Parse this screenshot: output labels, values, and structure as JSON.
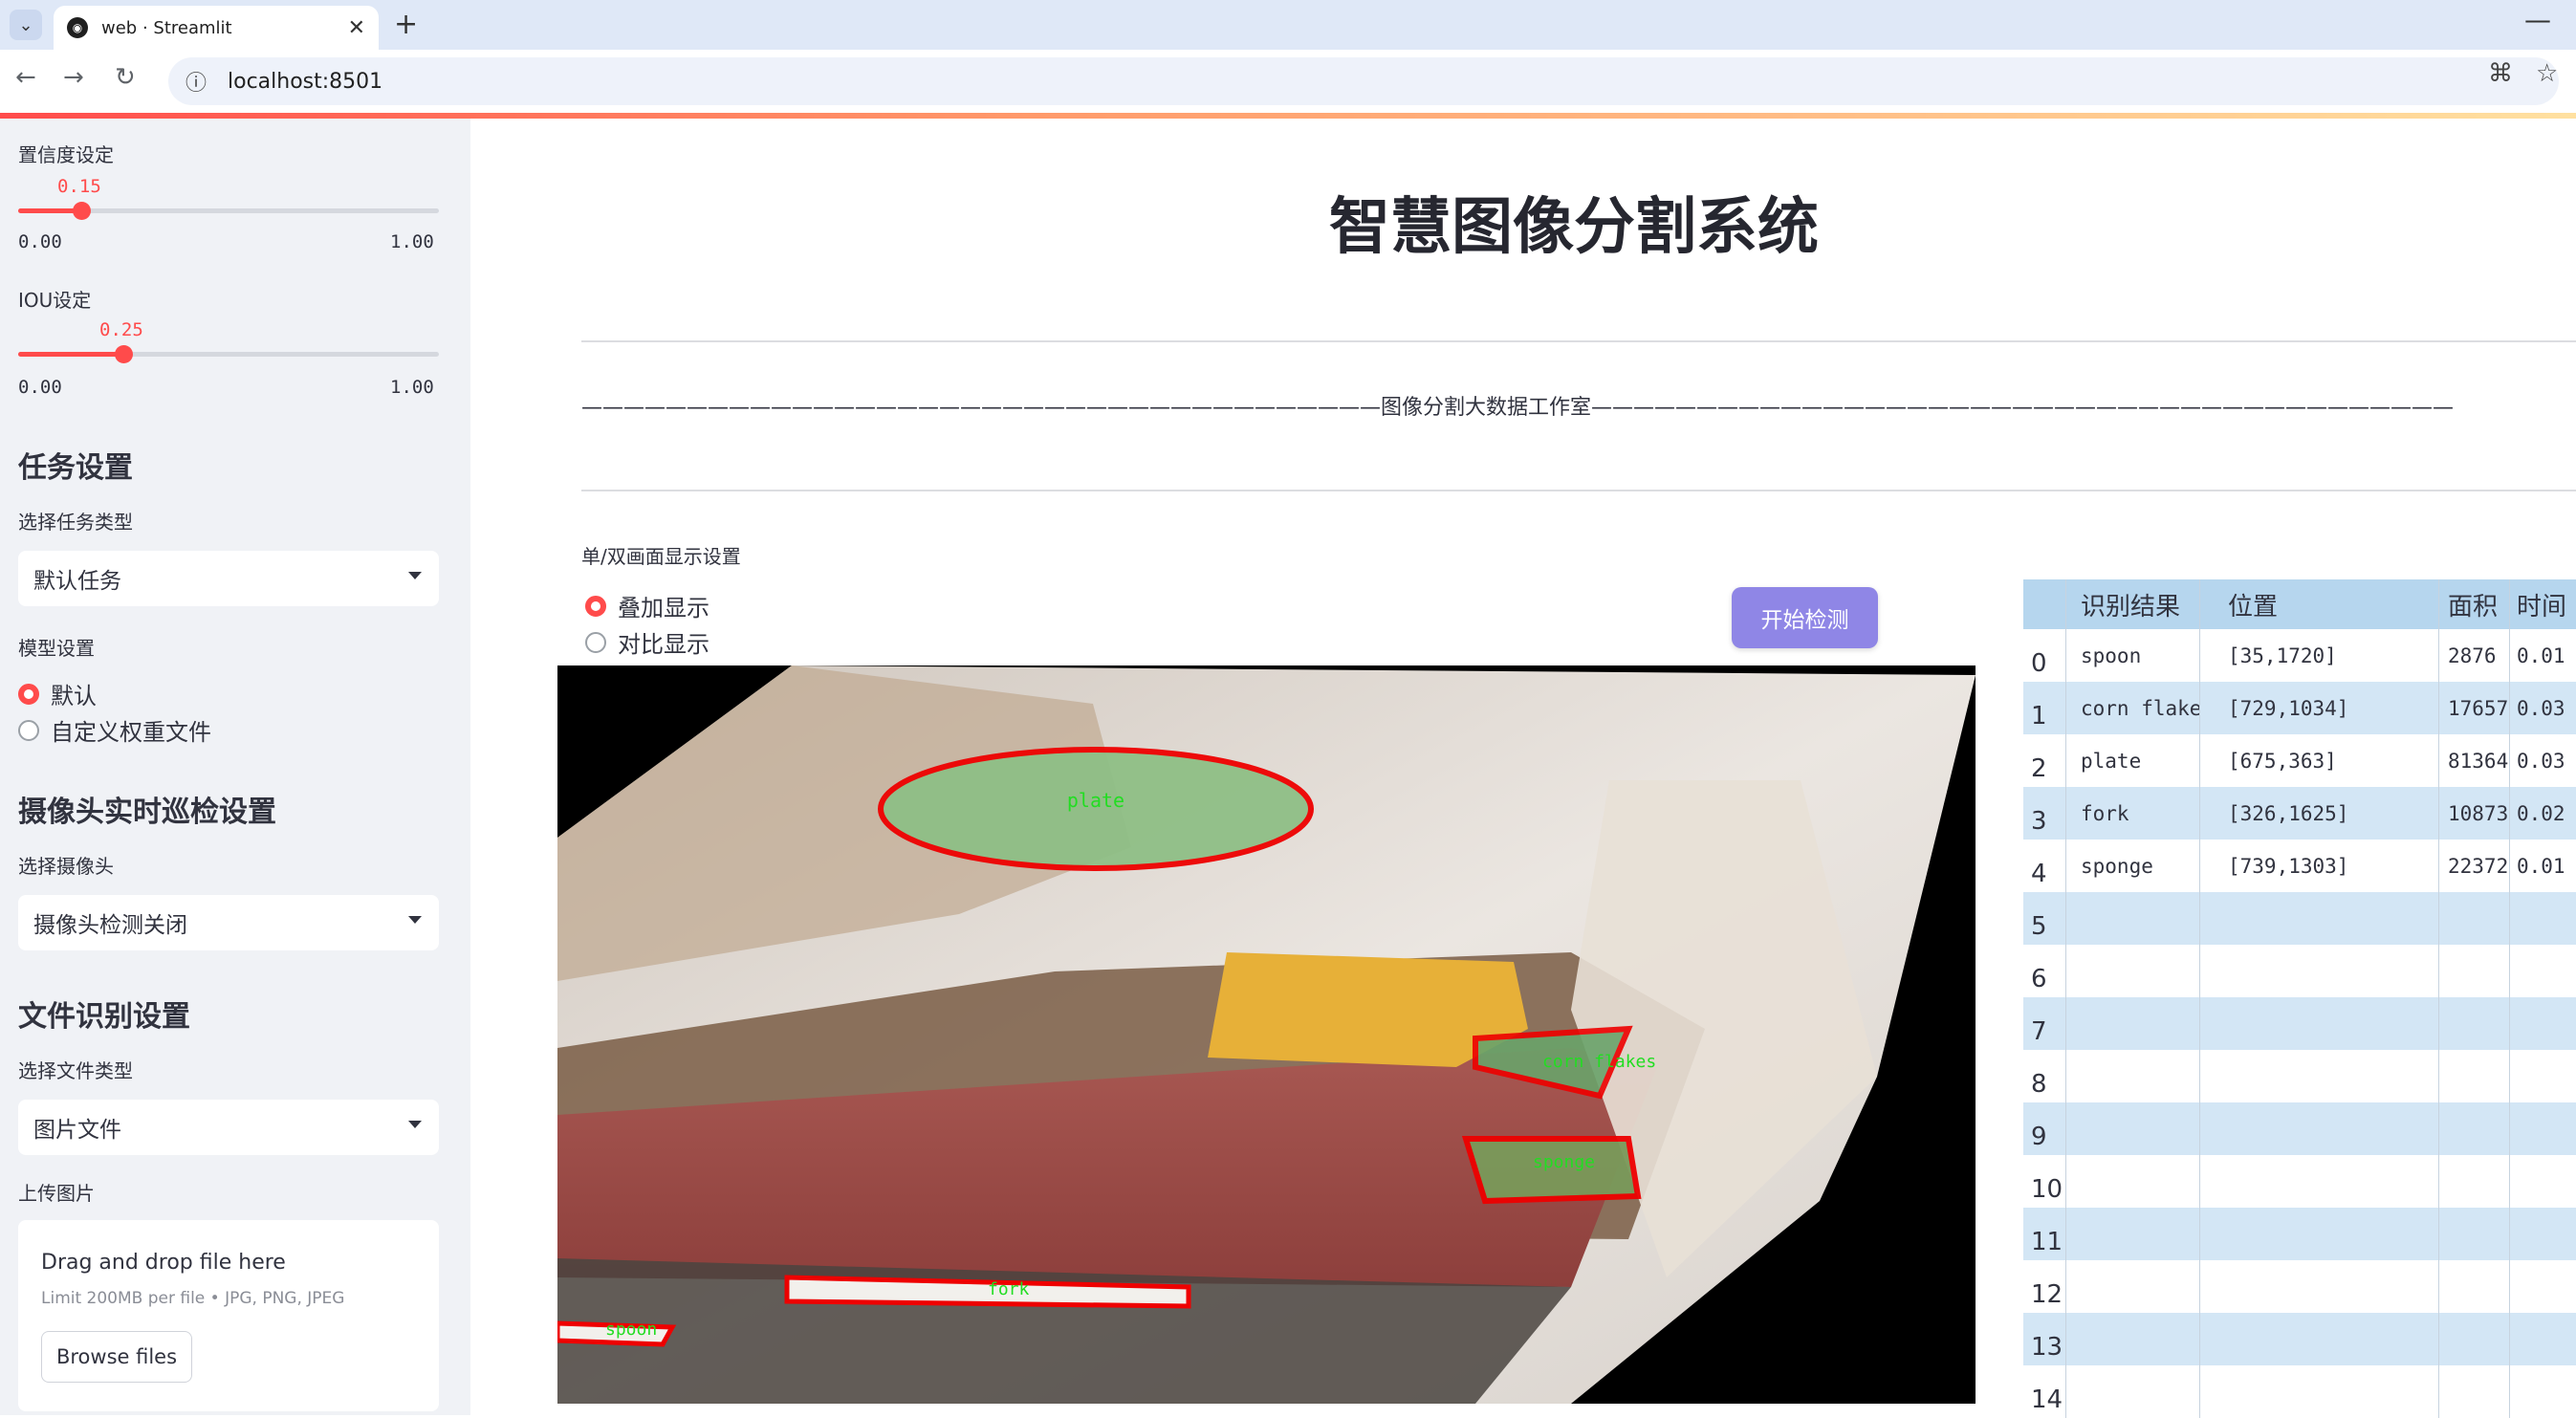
{
  "browser": {
    "tab_title": "web · Streamlit",
    "url": "localhost:8501"
  },
  "sidebar": {
    "confidence": {
      "label": "置信度设定",
      "value": "0.15",
      "value_num": 0.15,
      "min": "0.00",
      "max": "1.00"
    },
    "iou": {
      "label": "IOU设定",
      "value": "0.25",
      "value_num": 0.25,
      "min": "0.00",
      "max": "1.00"
    },
    "task_header": "任务设置",
    "task_type_label": "选择任务类型",
    "task_type_value": "默认任务",
    "model_label": "模型设置",
    "model_options": [
      "默认",
      "自定义权重文件"
    ],
    "camera_header": "摄像头实时巡检设置",
    "camera_label": "选择摄像头",
    "camera_value": "摄像头检测关闭",
    "file_header": "文件识别设置",
    "file_type_label": "选择文件类型",
    "file_type_value": "图片文件",
    "upload_label": "上传图片",
    "upload_title": "Drag and drop file here",
    "upload_limit": "Limit 200MB per file • JPG, PNG, JPEG",
    "browse_label": "Browse files"
  },
  "main": {
    "title": "智慧图像分割系统",
    "studio_line": "——————————————————————————————————————图像分割大数据工作室—————————————————————————————————————————",
    "display_label": "单/双画面显示设置",
    "display_options": [
      "叠加显示",
      "对比显示"
    ],
    "start_button": "开始检测",
    "detections": [
      "plate",
      "corn flakes",
      "sponge",
      "fork",
      "spoon"
    ]
  },
  "table": {
    "headers": [
      "识别结果",
      "位置",
      "面积",
      "时间"
    ],
    "rows": [
      {
        "idx": "0",
        "name": "spoon",
        "pos": "[35,1720]",
        "area": "2876",
        "time": "0.01"
      },
      {
        "idx": "1",
        "name": "corn flakes",
        "pos": "[729,1034]",
        "area": "17657",
        "time": "0.03"
      },
      {
        "idx": "2",
        "name": "plate",
        "pos": "[675,363]",
        "area": "81364",
        "time": "0.03"
      },
      {
        "idx": "3",
        "name": "fork",
        "pos": "[326,1625]",
        "area": "10873",
        "time": "0.02"
      },
      {
        "idx": "4",
        "name": "sponge",
        "pos": "[739,1303]",
        "area": "22372",
        "time": "0.01"
      },
      {
        "idx": "5"
      },
      {
        "idx": "6"
      },
      {
        "idx": "7"
      },
      {
        "idx": "8"
      },
      {
        "idx": "9"
      },
      {
        "idx": "10"
      },
      {
        "idx": "11"
      },
      {
        "idx": "12"
      },
      {
        "idx": "13"
      },
      {
        "idx": "14"
      }
    ]
  },
  "colors": {
    "accent": "#ff4b4b",
    "button": "#8f86e6",
    "table_stripe": "#d3e6f5",
    "table_head": "#b6d6ee",
    "mask_label": "#22dd22"
  }
}
